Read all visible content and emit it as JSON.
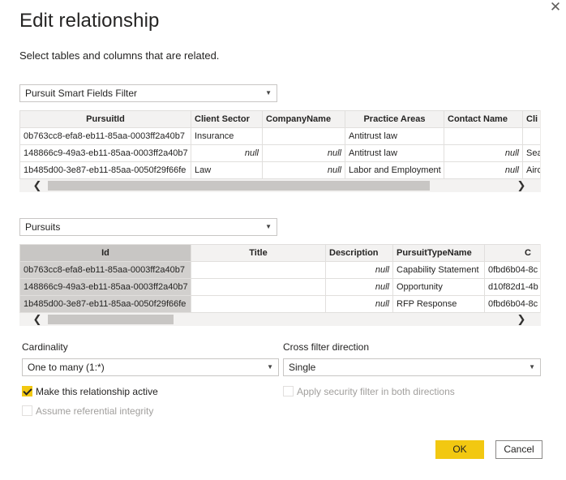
{
  "dialog": {
    "title": "Edit relationship",
    "subtitle": "Select tables and columns that are related.",
    "close_glyph": "✕"
  },
  "table1": {
    "selected": "Pursuit Smart Fields Filter",
    "columns": [
      "PursuitId",
      "Client Sector",
      "CompanyName",
      "Practice Areas",
      "Contact Name",
      "Cli"
    ],
    "rows": [
      [
        "0b763cc8-efa8-eb11-85aa-0003ff2a40b7",
        "Insurance",
        "",
        "Antitrust law",
        "",
        ""
      ],
      [
        "148866c9-49a3-eb11-85aa-0003ff2a40b7",
        "null",
        "null",
        "Antitrust law",
        "null",
        "Sea"
      ],
      [
        "1b485d00-3e87-eb11-85aa-0050f29f66fe",
        "Law",
        "null",
        "Labor and Employment",
        "null",
        "Airc"
      ]
    ]
  },
  "table2": {
    "selected": "Pursuits",
    "columns": [
      "Id",
      "Title",
      "Description",
      "PursuitTypeName",
      "C"
    ],
    "rows": [
      [
        "0b763cc8-efa8-eb11-85aa-0003ff2a40b7",
        "",
        "null",
        "Capability Statement",
        "0fbd6b04-8c"
      ],
      [
        "148866c9-49a3-eb11-85aa-0003ff2a40b7",
        "",
        "null",
        "Opportunity",
        "d10f82d1-4b"
      ],
      [
        "1b485d00-3e87-eb11-85aa-0050f29f66fe",
        "",
        "null",
        "RFP Response",
        "0fbd6b04-8c"
      ]
    ]
  },
  "cardinality": {
    "label": "Cardinality",
    "value": "One to many (1:*)"
  },
  "cross_filter": {
    "label": "Cross filter direction",
    "value": "Single"
  },
  "options": {
    "make_active": {
      "label": "Make this relationship active",
      "checked": true
    },
    "security_filter": {
      "label": "Apply security filter in both directions",
      "checked": false,
      "disabled": true
    },
    "referential": {
      "label": "Assume referential integrity",
      "checked": false,
      "disabled": true
    }
  },
  "buttons": {
    "ok": "OK",
    "cancel": "Cancel"
  },
  "colors": {
    "accent": "#f2c811",
    "header_bg": "#f3f2f1",
    "selected_col": "#c8c6c4"
  },
  "icons": {
    "dropdown": "chevron-down-icon",
    "scroll_left": "chevron-left-icon",
    "scroll_right": "chevron-right-icon"
  }
}
